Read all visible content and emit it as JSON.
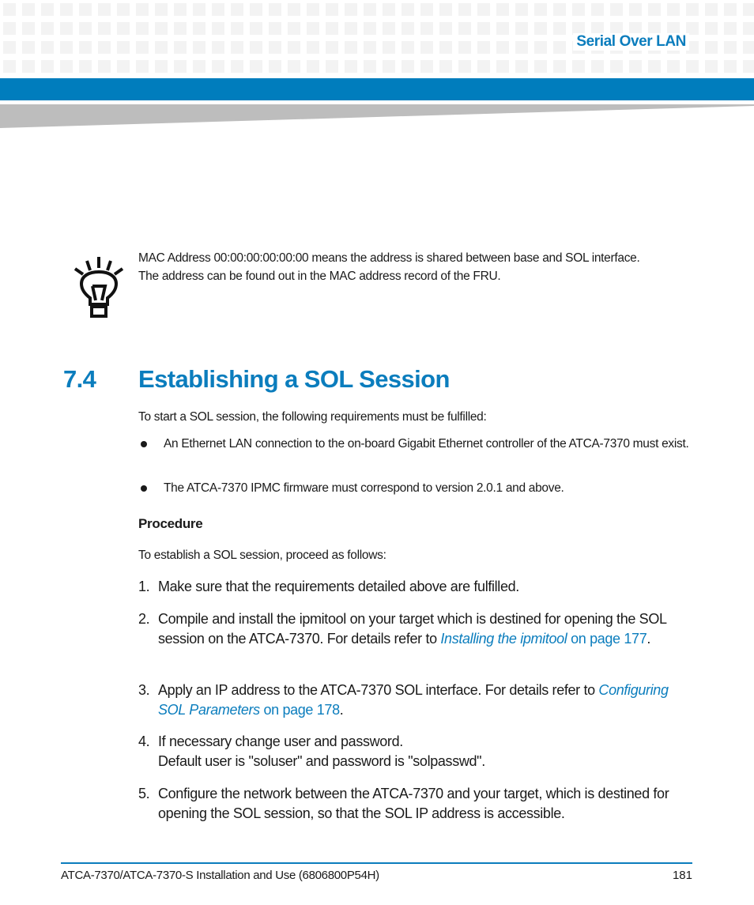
{
  "header": {
    "chapter_title": "Serial Over LAN",
    "colors": {
      "brand_blue": "#007dbd",
      "heading_blue": "#0b7dbd",
      "grid_square": "#f3f3f3",
      "wedge_gray": "#bdbdbd"
    }
  },
  "tip": {
    "icon": "lightbulb-icon",
    "text": "MAC Address 00:00:00:00:00:00 means the address is shared between base and SOL interface. The address can be found out in the MAC address record of the FRU."
  },
  "section": {
    "number": "7.4",
    "title": "Establishing a SOL Session",
    "intro": "To start a SOL session, the following requirements must be fulfilled:",
    "requirements": [
      "An Ethernet LAN connection to the on-board Gigabit Ethernet controller of the ATCA-7370 must exist.",
      "The ATCA-7370 IPMC firmware must correspond to version 2.0.1 and above."
    ],
    "procedure_heading": "Procedure",
    "procedure_intro": "To establish a SOL session, proceed as follows:",
    "steps": [
      {
        "num": "1.",
        "text": "Make sure that the requirements detailed above are fulfilled."
      },
      {
        "num": "2.",
        "text": "Compile and install the ipmitool on your target which is destined for opening the SOL session on the ATCA-7370. For details refer to ",
        "link_italic": "Installing the ipmitool",
        "link_rest": " on page 177",
        "after": "."
      },
      {
        "num": "3.",
        "text": "Apply an IP address to the ATCA-7370 SOL interface. For details refer to ",
        "link_italic": "Configuring SOL Parameters",
        "link_rest": " on page 178",
        "after": "."
      },
      {
        "num": "4.",
        "text": "If necessary change user and password.",
        "line2": "Default user is \"soluser\" and password is \"solpasswd\"."
      },
      {
        "num": "5.",
        "text": "Configure the network between the ATCA-7370 and your target, which is destined for opening the SOL session, so that the SOL IP address is accessible."
      }
    ]
  },
  "footer": {
    "document_title": "ATCA-7370/ATCA-7370-S Installation and Use (6806800P54H)",
    "page_number": "181"
  }
}
